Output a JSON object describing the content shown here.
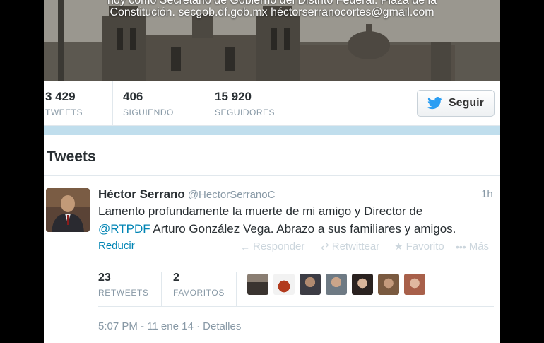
{
  "header": {
    "bio_line_1": "hoy como Secretario de Gobierno del Distrito Federal. Plaza de la",
    "bio_line_2": "Constitución. secgob.df.gob.mx héctorserranocortes@gmail.com"
  },
  "profile_stats": [
    {
      "value": "3 429",
      "label": "TWEETS"
    },
    {
      "value": "406",
      "label": "SIGUIENDO"
    },
    {
      "value": "15 920",
      "label": "SEGUIDORES"
    }
  ],
  "follow_button": {
    "label": "Seguir",
    "icon": "twitter-bird-icon",
    "icon_color": "#2b9ef3"
  },
  "section_title": "Tweets",
  "tweet": {
    "author_name": "Héctor Serrano",
    "author_handle": "@HectorSerranoC",
    "time": "1h",
    "text_line_1": "Lamento profundamente la muerte de mi amigo y Director de",
    "mention": "@RTPDF",
    "text_line_2_rest": " Arturo González Vega. Abrazo a sus familiares y amigos.",
    "collapse_label": "Reducir",
    "actions": [
      {
        "label": "Responder",
        "icon": "reply-icon"
      },
      {
        "label": "Retwittear",
        "icon": "retweet-icon"
      },
      {
        "label": "Favorito",
        "icon": "star-icon"
      },
      {
        "label": "Más",
        "icon": "more-icon"
      }
    ],
    "retweets": {
      "value": "23",
      "label": "RETWEETS"
    },
    "favorites": {
      "value": "2",
      "label": "FAVORITOS"
    },
    "timestamp": "5:07 PM - 11 ene 14",
    "details_label": "Detalles"
  },
  "colors": {
    "link": "#0084b4",
    "muted": "#8899a6",
    "accent_strip": "#c0deed"
  }
}
